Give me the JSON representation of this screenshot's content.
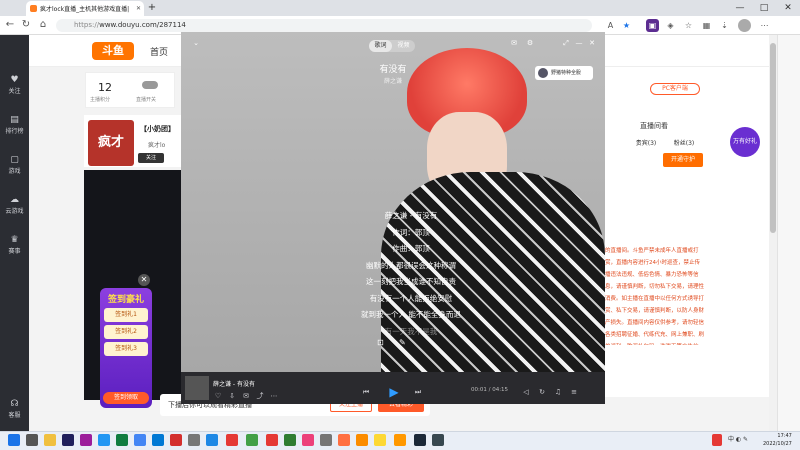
{
  "browser": {
    "tab_title": "疯才lock直播_主机其他游戏直播|",
    "url_scheme": "https://",
    "url_rest": "www.douyu.com/287114",
    "new_tab": "+"
  },
  "window": {
    "minimize": "—",
    "maximize": "□",
    "close": "✕"
  },
  "left_rail": [
    {
      "icon": "heart-icon",
      "glyph": "♥",
      "label": "关注"
    },
    {
      "icon": "rank-icon",
      "glyph": "▤",
      "label": "排行榜"
    },
    {
      "icon": "game-icon",
      "glyph": "▢",
      "label": "游戏"
    },
    {
      "icon": "cloud-game-icon",
      "glyph": "☁",
      "label": "云游戏"
    },
    {
      "icon": "trophy-icon",
      "glyph": "♛",
      "label": "赛事"
    },
    {
      "icon": "headset-icon",
      "glyph": "☊",
      "label": "客服"
    }
  ],
  "site": {
    "logo": "斗鱼",
    "nav_home": "首页",
    "user_level": "12",
    "user_level_label": "主播积分",
    "stream_switch_label": "直播开关",
    "streamer_name": "疯才",
    "streamer_sub": "【小奶团】",
    "streamer_extra": "疯才lo",
    "badge_follow": "关注",
    "pc_client": "PC客户端",
    "rank_tab": "直播间看",
    "right_tabs": [
      "贵宾(3)",
      "粉丝(3)"
    ],
    "open_guard": "开通守护",
    "notice": "的直播间。斗鱼严禁未成年人直播或打赏，直播内容进行24小时巡查，禁止传播违法违规、低俗色情、暴力恐怖等信息，请谨慎判断，切勿私下交易，请理性消费。如主播在直播中以任何方式诱导打赏、私下交易，请谨慎判断，以防人身财产损失。直播间内容仅供参考，请勿轻信各类招聘征婚、代练代充、网上兼职、刷单返利、购买礼包码、游戏币等广告信息。",
    "ad_badge": "万有好礼"
  },
  "promo": {
    "title": "签到豪礼",
    "rows": [
      "签到礼1",
      "签到礼2",
      "签到礼3"
    ],
    "cta": "签到领取"
  },
  "bottom_bar": {
    "text": "下播后你可以观看精彩直播",
    "btn1": "关注主播",
    "btn2": "去看精彩"
  },
  "player": {
    "toggle": [
      "歌词",
      "视频"
    ],
    "song_title": "有没有",
    "artist": "薛之谦",
    "follow_text": "野猪特种全服",
    "lyrics": [
      "薛之谦 - 有没有",
      "作词：郭顶",
      "作曲：郭顶",
      "幽默的人都很误会这种称谓",
      "这一刻把我当成谁不知自责",
      "有没有一个人能拒绝安慰",
      "就到我一个人 能不能全身而退",
      "有一天我不是我"
    ],
    "ctrl_title": "薛之谦 - 有没有",
    "time": "00:01 / 04:15",
    "play": "▶",
    "prev": "⏮",
    "next": "⏭"
  },
  "clock": {
    "time": "17:47",
    "date": "2022/10/27"
  },
  "colors": {
    "accent": "#ff5a29",
    "douyu_orange": "#ff7400",
    "player_blue": "#2f9cff"
  }
}
